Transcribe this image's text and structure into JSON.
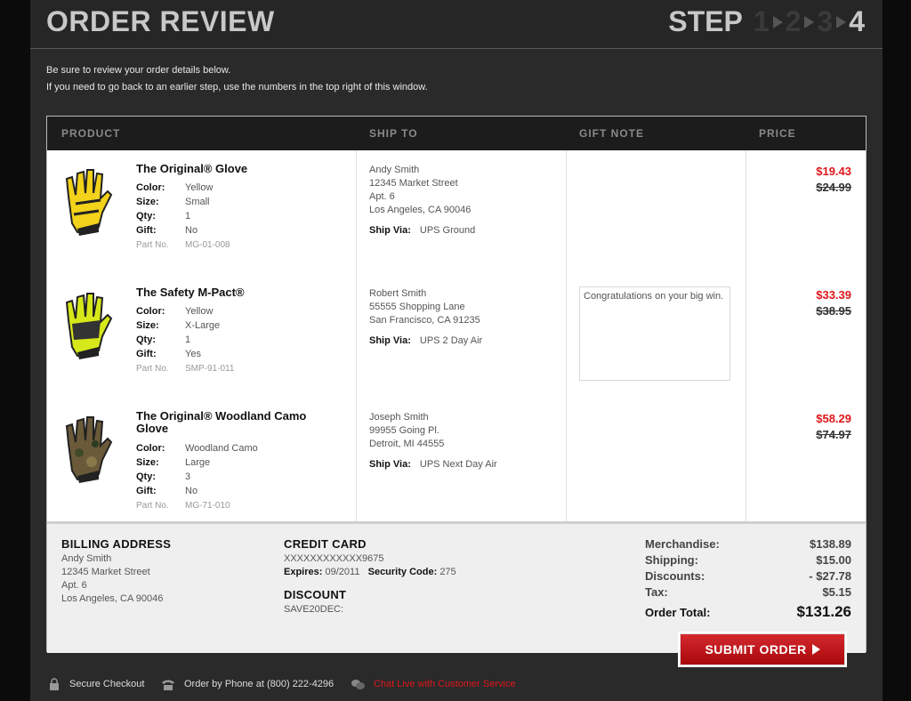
{
  "header": {
    "title": "ORDER REVIEW",
    "step_word": "STEP",
    "steps": [
      "1",
      "2",
      "3",
      "4"
    ],
    "current_step": "4"
  },
  "intro": [
    "Be sure to review your order details below.",
    "If you need to go back to an earlier step, use the numbers in the top right of this window."
  ],
  "columns": {
    "product": "PRODUCT",
    "ship_to": "SHIP TO",
    "gift_note": "GIFT NOTE",
    "price": "PRICE"
  },
  "labels": {
    "color": "Color:",
    "size": "Size:",
    "qty": "Qty:",
    "gift": "Gift:",
    "part": "Part No.",
    "ship_via": "Ship Via:"
  },
  "items": [
    {
      "name": "The Original® Glove",
      "color": "Yellow",
      "size": "Small",
      "qty": "1",
      "gift": "No",
      "part": "MG-01-008",
      "ship": [
        "Andy Smith",
        "12345 Market Street",
        "Apt. 6",
        "Los Angeles, CA 90046"
      ],
      "ship_via": "UPS Ground",
      "gift_note": "",
      "price": "$19.43",
      "old_price": "$24.99",
      "glove_color": "#f2d21a"
    },
    {
      "name": "The Safety M-Pact®",
      "color": "Yellow",
      "size": "X-Large",
      "qty": "1",
      "gift": "Yes",
      "part": "SMP-91-011",
      "ship": [
        "Robert Smith",
        "55555 Shopping Lane",
        "San Francisco, CA 91235"
      ],
      "ship_via": "UPS 2 Day Air",
      "gift_note": "Congratulations on your big win.",
      "price": "$33.39",
      "old_price": "$38.95",
      "glove_color": "#d7e81a"
    },
    {
      "name": "The Original® Woodland Camo Glove",
      "color": "Woodland Camo",
      "size": "Large",
      "qty": "3",
      "gift": "No",
      "part": "MG-71-010",
      "ship": [
        "Joseph Smith",
        "99955 Going Pl.",
        "Detroit, MI 44555"
      ],
      "ship_via": "UPS Next Day Air",
      "gift_note": "",
      "price": "$58.29",
      "old_price": "$74.97",
      "glove_color": "#6b5a3a"
    }
  ],
  "billing": {
    "heading": "BILLING ADDRESS",
    "lines": [
      "Andy Smith",
      "12345 Market Street",
      "Apt. 6",
      "Los Angeles, CA 90046"
    ]
  },
  "credit_card": {
    "heading": "CREDIT CARD",
    "number": "XXXXXXXXXXXX9675",
    "expires_label": "Expires:",
    "expires": "09/2011",
    "security_label": "Security Code:",
    "security": "275"
  },
  "discount": {
    "heading": "DISCOUNT",
    "code": "SAVE20DEC:"
  },
  "totals": {
    "merch_label": "Merchandise:",
    "merch": "$138.89",
    "ship_label": "Shipping:",
    "ship": "$15.00",
    "disc_label": "Discounts:",
    "disc": "- $27.78",
    "tax_label": "Tax:",
    "tax": "$5.15",
    "total_label": "Order Total:",
    "total": "$131.26"
  },
  "submit_label": "SUBMIT ORDER",
  "footer": {
    "secure": "Secure Checkout",
    "phone": "Order by Phone at (800) 222-4296",
    "chat": "Chat Live with Customer Service"
  },
  "colors": {
    "accent_red": "#e0161b",
    "button_red": "#b8121a"
  }
}
